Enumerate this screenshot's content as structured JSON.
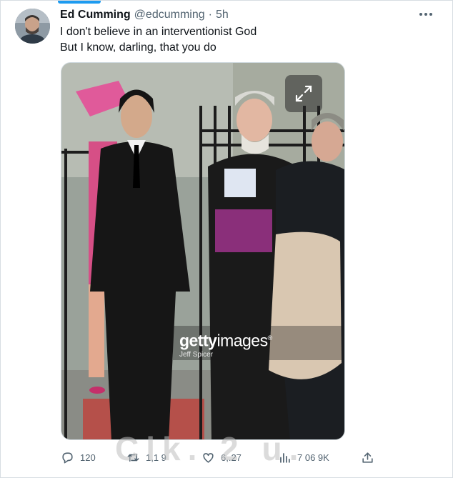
{
  "tweet": {
    "author": {
      "name": "Ed Cumming",
      "handle": "@edcumming"
    },
    "separator": "·",
    "time": "5h",
    "text_lines": [
      "I don't believe in an interventionist God",
      "But I know, darling, that you do"
    ],
    "media": {
      "watermark_brand_bold": "getty",
      "watermark_brand_rest": "images",
      "watermark_registered": "®",
      "photo_credit": "Jeff Spicer",
      "expand_icon": "expand-arrows-icon"
    },
    "actions": {
      "replies": "120",
      "retweets": "1,1 9",
      "likes": "6,.27",
      "views": "7 06 9K"
    },
    "overlay_watermark": "Clk.  2  u."
  },
  "colors": {
    "accent": "#1d9bf0",
    "text_primary": "#0f1419",
    "text_secondary": "#536471",
    "border": "#cfd9de"
  }
}
